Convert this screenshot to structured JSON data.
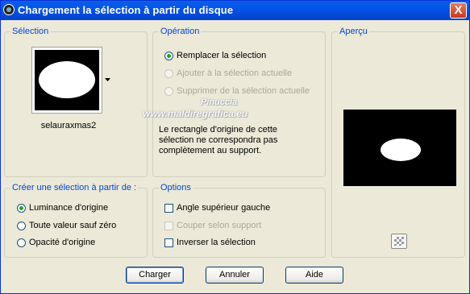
{
  "window": {
    "title": "Chargement la sélection à partir du disque",
    "close_label": "X"
  },
  "selection": {
    "group_title": "Sélection",
    "file_name": "selauraxmas2"
  },
  "operation": {
    "group_title": "Opération",
    "options": [
      {
        "label": "Remplacer la sélection",
        "selected": true,
        "enabled": true
      },
      {
        "label": "Ajouter à la sélection actuelle",
        "selected": false,
        "enabled": false
      },
      {
        "label": "Supprimer de la sélection actuelle",
        "selected": false,
        "enabled": false
      }
    ],
    "message": "Le rectangle d'origine de cette sélection ne correspondra pas complètement au support."
  },
  "preview": {
    "group_title": "Aperçu"
  },
  "create_from": {
    "group_title": "Créer une sélection à partir de :",
    "options": [
      {
        "label": "Luminance d'origine",
        "selected": true
      },
      {
        "label": "Toute valeur sauf zéro",
        "selected": false
      },
      {
        "label": "Opacité d'origine",
        "selected": false
      }
    ]
  },
  "options": {
    "group_title": "Options",
    "items": [
      {
        "label": "Angle supérieur gauche",
        "checked": false,
        "enabled": true
      },
      {
        "label": "Couper selon support",
        "checked": false,
        "enabled": false
      },
      {
        "label": "Inverser la sélection",
        "checked": false,
        "enabled": true
      }
    ]
  },
  "buttons": {
    "load": "Charger",
    "cancel": "Annuler",
    "help": "Aide"
  },
  "watermark": {
    "line1": "Pinuccia",
    "line2": "www.maldiregrafica.eu"
  }
}
